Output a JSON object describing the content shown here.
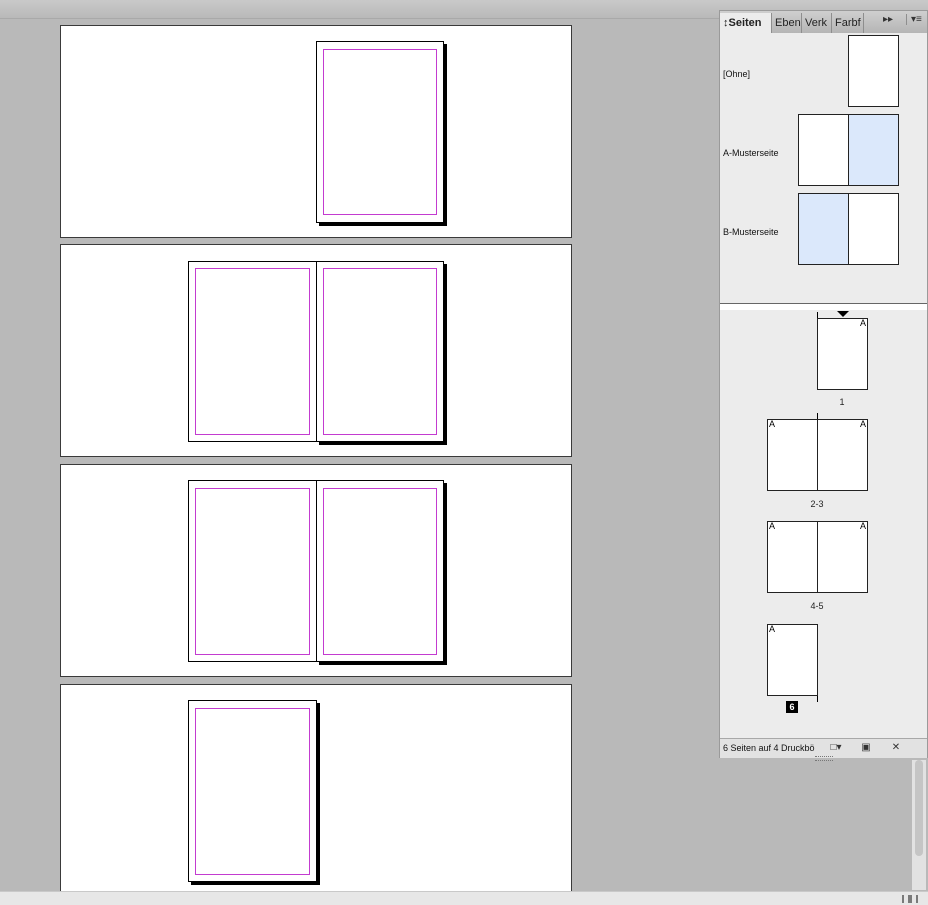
{
  "panel": {
    "tabs": [
      {
        "label": "↕Seiten",
        "active": true
      },
      {
        "label": "Eben"
      },
      {
        "label": "Verk"
      },
      {
        "label": "Farbf"
      }
    ],
    "more_glyph": "▸▸",
    "menu_glyph": "▾≡",
    "masters": [
      {
        "label": "[Ohne]"
      },
      {
        "label": "A-Musterseite"
      },
      {
        "label": "B-Musterseite"
      }
    ],
    "page_letter": "A",
    "page_numbers": {
      "p1": "1",
      "p23": "2-3",
      "p45": "4-5",
      "p6": "6"
    },
    "footer_text": "6 Seiten auf 4 Druckbö",
    "icons": {
      "new_page": "new-page-icon",
      "trash": "trash-icon",
      "edit_size": "page-size-icon"
    }
  },
  "colors": {
    "margin_guide": "#c33bd0",
    "selected_master": "#dbe8fb"
  }
}
